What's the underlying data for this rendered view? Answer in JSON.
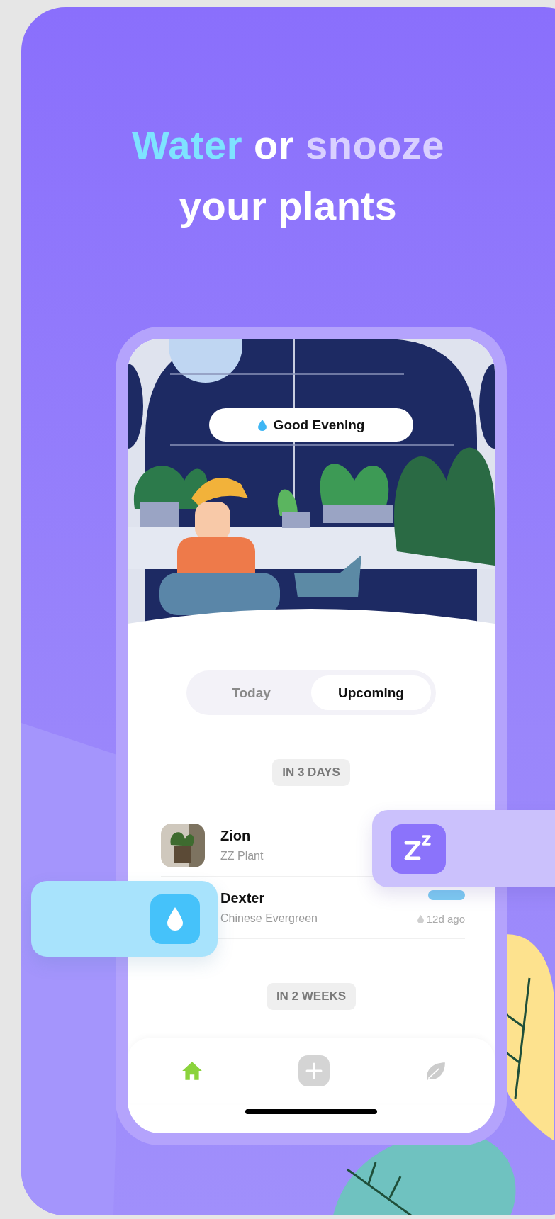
{
  "headline": {
    "lines": [
      [
        {
          "text": "Water",
          "kind": "water"
        },
        {
          "text": "or",
          "kind": "plain"
        },
        {
          "text": "snooze",
          "kind": "snooze"
        }
      ],
      [
        {
          "text": "your plants",
          "kind": "plain"
        }
      ]
    ]
  },
  "greeting": "Good Evening",
  "tabs": [
    {
      "label": "Today",
      "selected": false
    },
    {
      "label": "Upcoming",
      "selected": true
    }
  ],
  "sections": [
    {
      "heading": "IN 3 DAYS",
      "plants": [
        {
          "name": "Zion",
          "species": "ZZ Plant"
        },
        {
          "name": "Dexter",
          "species": "Chinese Evergreen",
          "level": 1,
          "last_watered": "12d ago"
        }
      ]
    },
    {
      "heading": "IN 2 WEEKS"
    }
  ],
  "nav": [
    {
      "kind": "home",
      "selected": true
    },
    {
      "kind": "add",
      "selected": false
    },
    {
      "kind": "leaf",
      "selected": false
    }
  ],
  "actions": [
    {
      "kind": "snooze"
    },
    {
      "kind": "water"
    }
  ]
}
